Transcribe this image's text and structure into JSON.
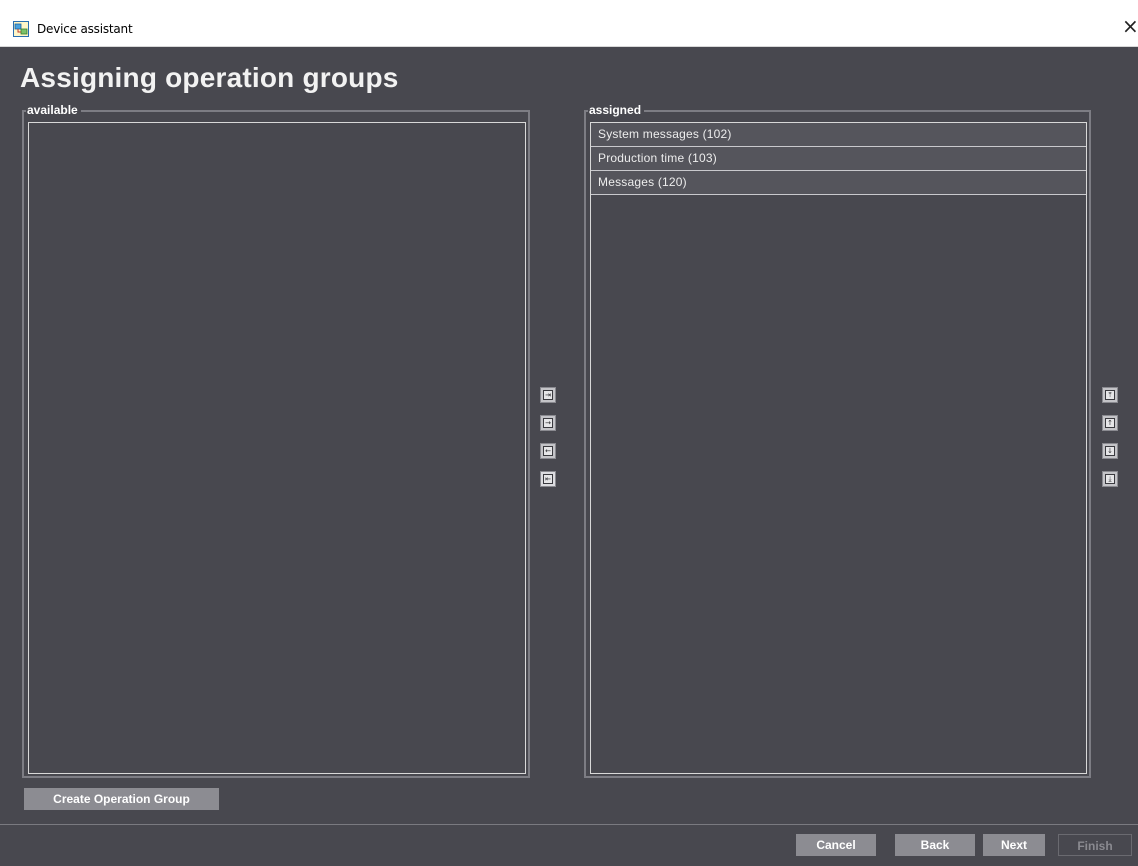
{
  "window": {
    "title": "Device assistant",
    "close_glyph": "×"
  },
  "page": {
    "title": "Assigning operation groups"
  },
  "available": {
    "label": "available",
    "items": []
  },
  "assigned": {
    "label": "assigned",
    "items": [
      "System messages (102)",
      "Production time (103)",
      "Messages (120)"
    ]
  },
  "transfer_buttons": [
    {
      "name": "move-all-right-icon",
      "glyph": "⇥"
    },
    {
      "name": "move-right-icon",
      "glyph": "→"
    },
    {
      "name": "move-left-icon",
      "glyph": "←"
    },
    {
      "name": "move-all-left-icon",
      "glyph": "⇤"
    }
  ],
  "order_buttons": [
    {
      "name": "move-to-top-icon",
      "glyph": "⤒"
    },
    {
      "name": "move-up-icon",
      "glyph": "↑"
    },
    {
      "name": "move-down-icon",
      "glyph": "↓"
    },
    {
      "name": "move-to-bottom-icon",
      "glyph": "⤓"
    }
  ],
  "create_button": "Create Operation Group",
  "footer": {
    "cancel": "Cancel",
    "back": "Back",
    "next": "Next",
    "finish": "Finish"
  },
  "colors": {
    "background": "#48484f",
    "button": "#8c8c92",
    "border": "#7d7d84"
  }
}
